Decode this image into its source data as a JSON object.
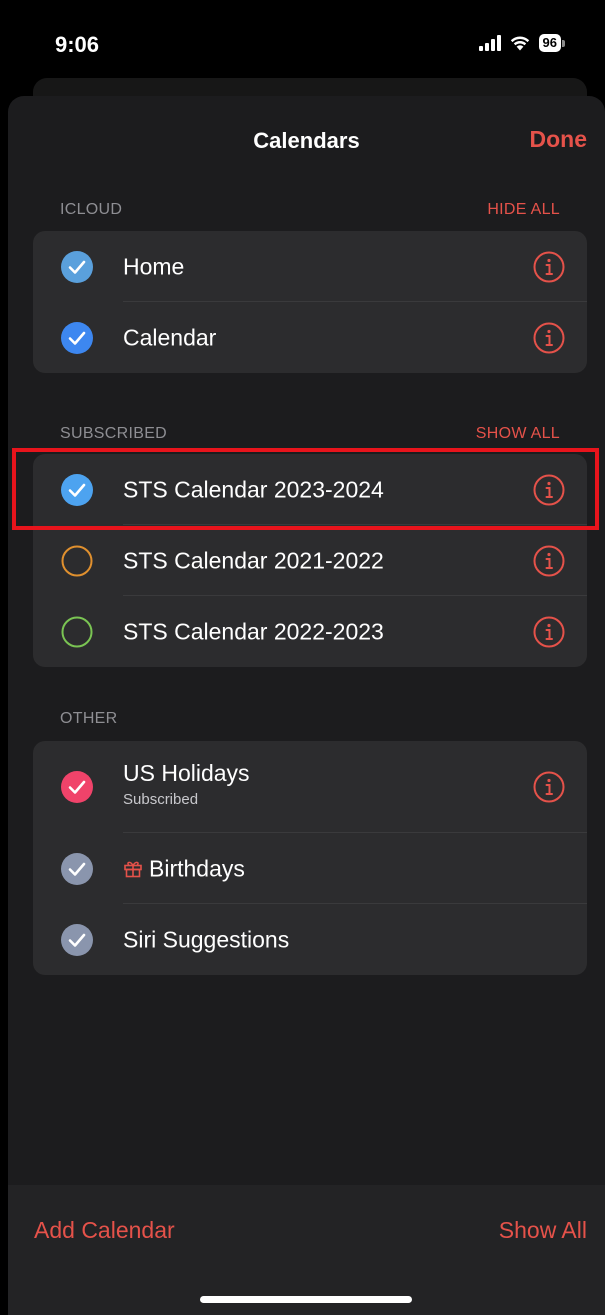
{
  "status_bar": {
    "time": "9:06",
    "battery": "96"
  },
  "header": {
    "title": "Calendars",
    "done_label": "Done"
  },
  "sections": {
    "icloud": {
      "label": "ICLOUD",
      "action": "HIDE ALL",
      "items": [
        {
          "label": "Home",
          "checked": true,
          "color": "#5aa0dc"
        },
        {
          "label": "Calendar",
          "checked": true,
          "color": "#3d87f0"
        }
      ]
    },
    "subscribed": {
      "label": "SUBSCRIBED",
      "action": "SHOW ALL",
      "items": [
        {
          "label": "STS Calendar 2023-2024",
          "checked": true,
          "color": "#4da3f0"
        },
        {
          "label": "STS Calendar 2021-2022",
          "checked": false,
          "color": "#e0902e"
        },
        {
          "label": "STS Calendar 2022-2023",
          "checked": false,
          "color": "#7ac453"
        }
      ]
    },
    "other": {
      "label": "OTHER",
      "items": [
        {
          "label": "US Holidays",
          "sublabel": "Subscribed",
          "checked": true,
          "color": "#f0436a"
        },
        {
          "label": "Birthdays",
          "checked": true,
          "color": "#8a95ad",
          "icon": "gift-icon"
        },
        {
          "label": "Siri Suggestions",
          "checked": true,
          "color": "#8a95ad"
        }
      ]
    }
  },
  "toolbar": {
    "add_calendar": "Add Calendar",
    "show_all": "Show All"
  },
  "colors": {
    "accent": "#e5524a",
    "highlight": "#e8141c"
  }
}
